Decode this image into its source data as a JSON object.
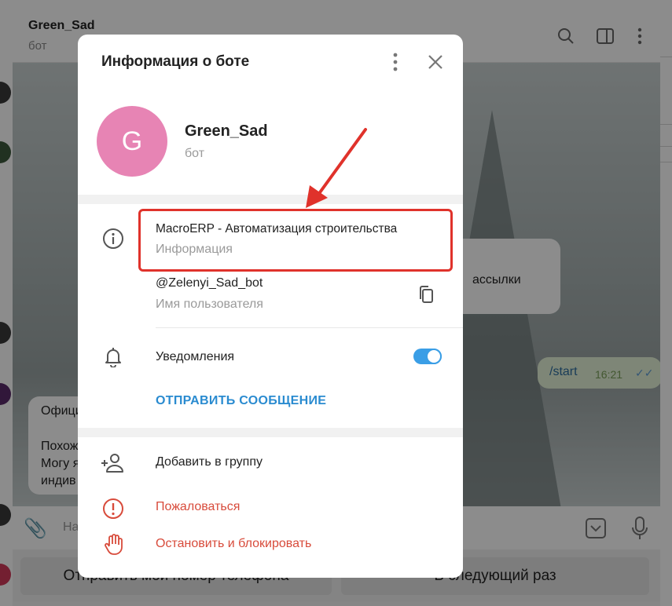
{
  "chat": {
    "name": "Green_Sad",
    "status": "бот",
    "incoming_snippet": "ассылки",
    "outgoing_text": "/start",
    "outgoing_time": "16:21",
    "outgoing_ticks": "✓✓",
    "message_lines": [
      "Офици",
      "Похож",
      "Могу я",
      "индив"
    ],
    "composer_placeholder": "На",
    "keyboard_buttons": [
      "Отправить мой номер телефона",
      "В следующий раз"
    ]
  },
  "modal": {
    "title": "Информация о боте",
    "avatar_letter": "G",
    "bot_name": "Green_Sad",
    "bot_status": "бот",
    "info_value": "MacroERP - Автоматизация строительства",
    "info_label": "Информация",
    "username_value": "@Zelenyi_Sad_bot",
    "username_label": "Имя пользователя",
    "notifications_label": "Уведомления",
    "notifications_on": true,
    "send_message": "ОТПРАВИТЬ СООБЩЕНИЕ",
    "add_to_group": "Добавить в группу",
    "report": "Пожаловаться",
    "stop_block": "Остановить и блокировать"
  },
  "colors": {
    "avatar": "#e784b4",
    "accent": "#2a8bd0",
    "toggle": "#3a9ee6",
    "danger": "#d84b3b",
    "highlight": "#e0322b"
  },
  "icons": [
    "search-icon",
    "sidebar-toggle-icon",
    "more-vertical-icon",
    "close-icon",
    "info-icon",
    "copy-icon",
    "bell-icon",
    "add-user-icon",
    "report-icon",
    "block-hand-icon",
    "attach-icon",
    "keyboard-icon",
    "mic-icon"
  ]
}
